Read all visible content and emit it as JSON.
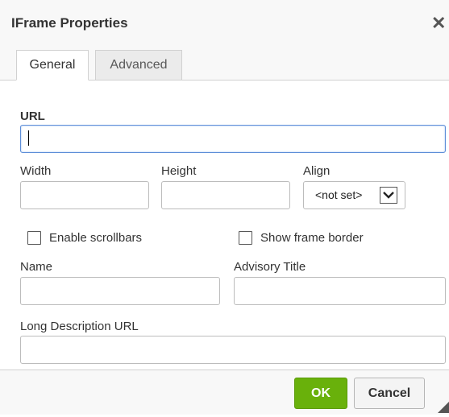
{
  "dialog": {
    "title": "IFrame Properties",
    "close_glyph": "✕"
  },
  "tabs": [
    {
      "label": "General",
      "active": true
    },
    {
      "label": "Advanced",
      "active": false
    }
  ],
  "form": {
    "url_label": "URL",
    "url_value": "",
    "width_label": "Width",
    "width_value": "",
    "height_label": "Height",
    "height_value": "",
    "align_label": "Align",
    "align_value": "<not set>",
    "scrollbars_label": "Enable scrollbars",
    "scrollbars_checked": false,
    "frameborder_label": "Show frame border",
    "frameborder_checked": false,
    "name_label": "Name",
    "name_value": "",
    "advisory_label": "Advisory Title",
    "advisory_value": "",
    "longdesc_label": "Long Description URL",
    "longdesc_value": ""
  },
  "footer": {
    "ok_label": "OK",
    "cancel_label": "Cancel"
  },
  "colors": {
    "ok_button": "#69b10b",
    "focus_border": "#5d8ed8"
  }
}
